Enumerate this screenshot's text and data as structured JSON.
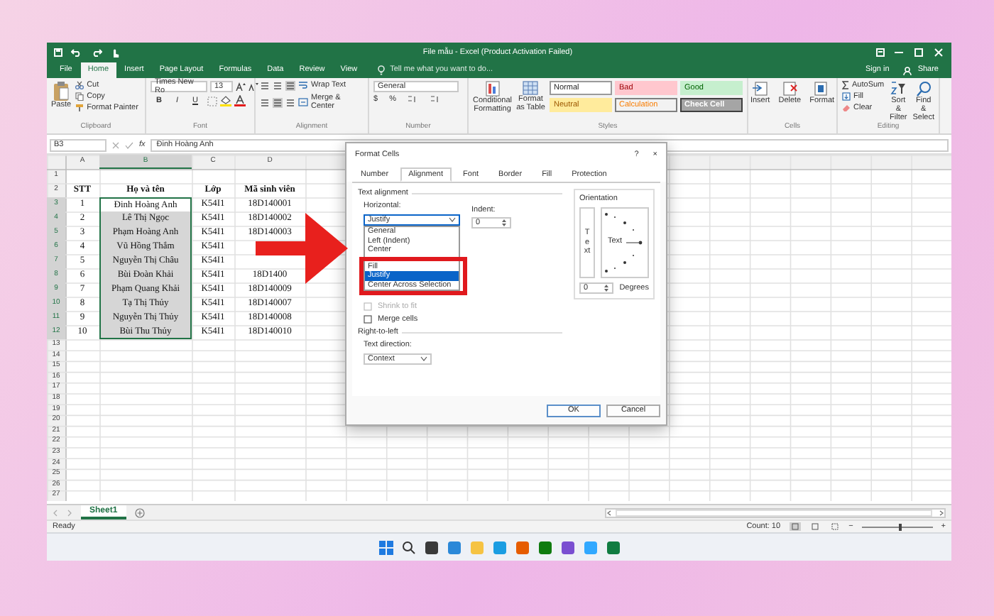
{
  "title_bar": {
    "title": "File mẫu - Excel (Product Activation Failed)"
  },
  "ribbon_tabs": [
    {
      "label": "File",
      "selected": false
    },
    {
      "label": "Home",
      "selected": true
    },
    {
      "label": "Insert",
      "selected": false
    },
    {
      "label": "Page Layout",
      "selected": false
    },
    {
      "label": "Formulas",
      "selected": false
    },
    {
      "label": "Data",
      "selected": false
    },
    {
      "label": "Review",
      "selected": false
    },
    {
      "label": "View",
      "selected": false
    }
  ],
  "tell_me": {
    "placeholder": "Tell me what you want to do..."
  },
  "account": {
    "sign_in": "Sign in",
    "share": "Share"
  },
  "ribbon": {
    "clipboard": {
      "paste": "Paste",
      "cut": "Cut",
      "copy": "Copy",
      "format_painter": "Format Painter",
      "label": "Clipboard"
    },
    "font": {
      "name": "Times New Ro",
      "size": "13",
      "bold": "B",
      "italic": "I",
      "underline": "U",
      "label": "Font"
    },
    "alignment": {
      "wrap": "Wrap Text",
      "merge": "Merge & Center",
      "label": "Alignment"
    },
    "number": {
      "format": "General",
      "symbols": [
        "$",
        "%"
      ],
      "label": "Number"
    },
    "styles": {
      "conditional": "Conditional Formatting",
      "format_table": "Format as Table",
      "cell_styles": [
        {
          "label": "Normal",
          "kind": "normal"
        },
        {
          "label": "Bad",
          "kind": "bad"
        },
        {
          "label": "Good",
          "kind": "good"
        },
        {
          "label": "Neutral",
          "kind": "neutral"
        },
        {
          "label": "Calculation",
          "kind": "calculation"
        },
        {
          "label": "Check Cell",
          "kind": "check"
        }
      ],
      "label": "Styles"
    },
    "cells": {
      "buttons": [
        "Insert",
        "Delete",
        "Format"
      ],
      "label": "Cells"
    },
    "editing": {
      "autosum": "AutoSum",
      "fill": "Fill",
      "clear": "Clear",
      "sort": "Sort & Filter",
      "find": "Find & Select",
      "label": "Editing"
    }
  },
  "formula_bar": {
    "name_box": "B3",
    "fx": "fx",
    "value": "Đinh Hoàng Anh"
  },
  "sheet": {
    "columns": [
      "A",
      "B",
      "C",
      "D"
    ],
    "rows": [
      {
        "number": "1",
        "cells": []
      },
      {
        "number": "2",
        "kind": "header",
        "cells": [
          "STT",
          "Họ và tên",
          "Lớp",
          "Mã sinh viên"
        ]
      },
      {
        "number": "3",
        "selected": true,
        "active": true,
        "cells": [
          "1",
          "Đinh Hoàng Anh",
          "K54I1",
          "18D140001"
        ]
      },
      {
        "number": "4",
        "selected": true,
        "active": false,
        "cells": [
          "2",
          "Lê Thị Ngọc",
          "K54I1",
          "18D140002"
        ]
      },
      {
        "number": "5",
        "selected": true,
        "active": false,
        "cells": [
          "3",
          "Phạm Hoàng Anh",
          "K54I1",
          "18D140003"
        ]
      },
      {
        "number": "6",
        "selected": true,
        "active": false,
        "cells": [
          "4",
          "Vũ Hồng Thắm",
          "K54I1",
          null
        ]
      },
      {
        "number": "7",
        "selected": true,
        "active": false,
        "cells": [
          "5",
          "Nguyễn Thị Châu",
          "K54I1",
          null
        ]
      },
      {
        "number": "8",
        "selected": true,
        "active": false,
        "cells": [
          "6",
          "Bùi Đoàn Khải",
          "K54I1",
          "18D1400"
        ]
      },
      {
        "number": "9",
        "selected": true,
        "active": false,
        "cells": [
          "7",
          "Phạm Quang Khải",
          "K54I1",
          "18D140009"
        ]
      },
      {
        "number": "10",
        "selected": true,
        "active": false,
        "cells": [
          "8",
          "Tạ Thị Thủy",
          "K54I1",
          "18D140007"
        ]
      },
      {
        "number": "11",
        "selected": true,
        "active": false,
        "cells": [
          "9",
          "Nguyễn Thị Thủy",
          "K54I1",
          "18D140008"
        ]
      },
      {
        "number": "12",
        "selected": true,
        "active": false,
        "cells": [
          "10",
          "Bùi Thu Thủy",
          "K54I1",
          "18D140010"
        ]
      },
      {
        "number": "13",
        "cells": []
      },
      {
        "number": "14",
        "cells": []
      },
      {
        "number": "15",
        "cells": []
      },
      {
        "number": "16",
        "cells": []
      },
      {
        "number": "17",
        "cells": []
      },
      {
        "number": "18",
        "cells": []
      },
      {
        "number": "19",
        "cells": []
      },
      {
        "number": "20",
        "cells": []
      },
      {
        "number": "21",
        "cells": []
      },
      {
        "number": "22",
        "cells": []
      },
      {
        "number": "23",
        "cells": []
      },
      {
        "number": "24",
        "cells": []
      },
      {
        "number": "25",
        "cells": []
      },
      {
        "number": "26",
        "cells": []
      },
      {
        "number": "27",
        "cells": []
      }
    ]
  },
  "dialog": {
    "title": "Format Cells",
    "help": "?",
    "close": "×",
    "tabs": [
      {
        "label": "Number",
        "selected": false
      },
      {
        "label": "Alignment",
        "selected": true
      },
      {
        "label": "Font",
        "selected": false
      },
      {
        "label": "Border",
        "selected": false
      },
      {
        "label": "Fill",
        "selected": false
      },
      {
        "label": "Protection",
        "selected": false
      }
    ],
    "text_alignment": "Text alignment",
    "horizontal_label": "Horizontal:",
    "horizontal_value": "Justify",
    "expanded": true,
    "options": [
      {
        "label": "General",
        "selected": false
      },
      {
        "label": "Left (Indent)",
        "selected": false
      },
      {
        "label": "Center",
        "selected": false
      },
      {
        "label": "Fill",
        "selected": false,
        "highlighted": true
      },
      {
        "label": "Justify",
        "selected": true,
        "highlighted": true
      },
      {
        "label": "Center Across Selection",
        "selected": false,
        "highlighted": true
      }
    ],
    "indent_label": "Indent:",
    "indent_value": "0",
    "checkboxes": [
      {
        "label": "Shrink to fit",
        "checked": false,
        "disabled": true
      },
      {
        "label": "Merge cells",
        "checked": false,
        "disabled": false
      }
    ],
    "rtl_label": "Right-to-left",
    "direction_label": "Text direction:",
    "direction_value": "Context",
    "orientation_label": "Orientation",
    "vertical_text": "Text",
    "dial_text": "Text",
    "degrees_value": "0",
    "degrees_label": "Degrees",
    "buttons": [
      "OK",
      "Cancel"
    ]
  },
  "sheet_tabs": [
    {
      "label": "Sheet1",
      "selected": true
    }
  ],
  "status_bar": {
    "ready": "Ready",
    "count": "Count: 10",
    "zoom": {
      "zoom_out": "−",
      "zoom_in": "+",
      "level": 0.55
    }
  }
}
